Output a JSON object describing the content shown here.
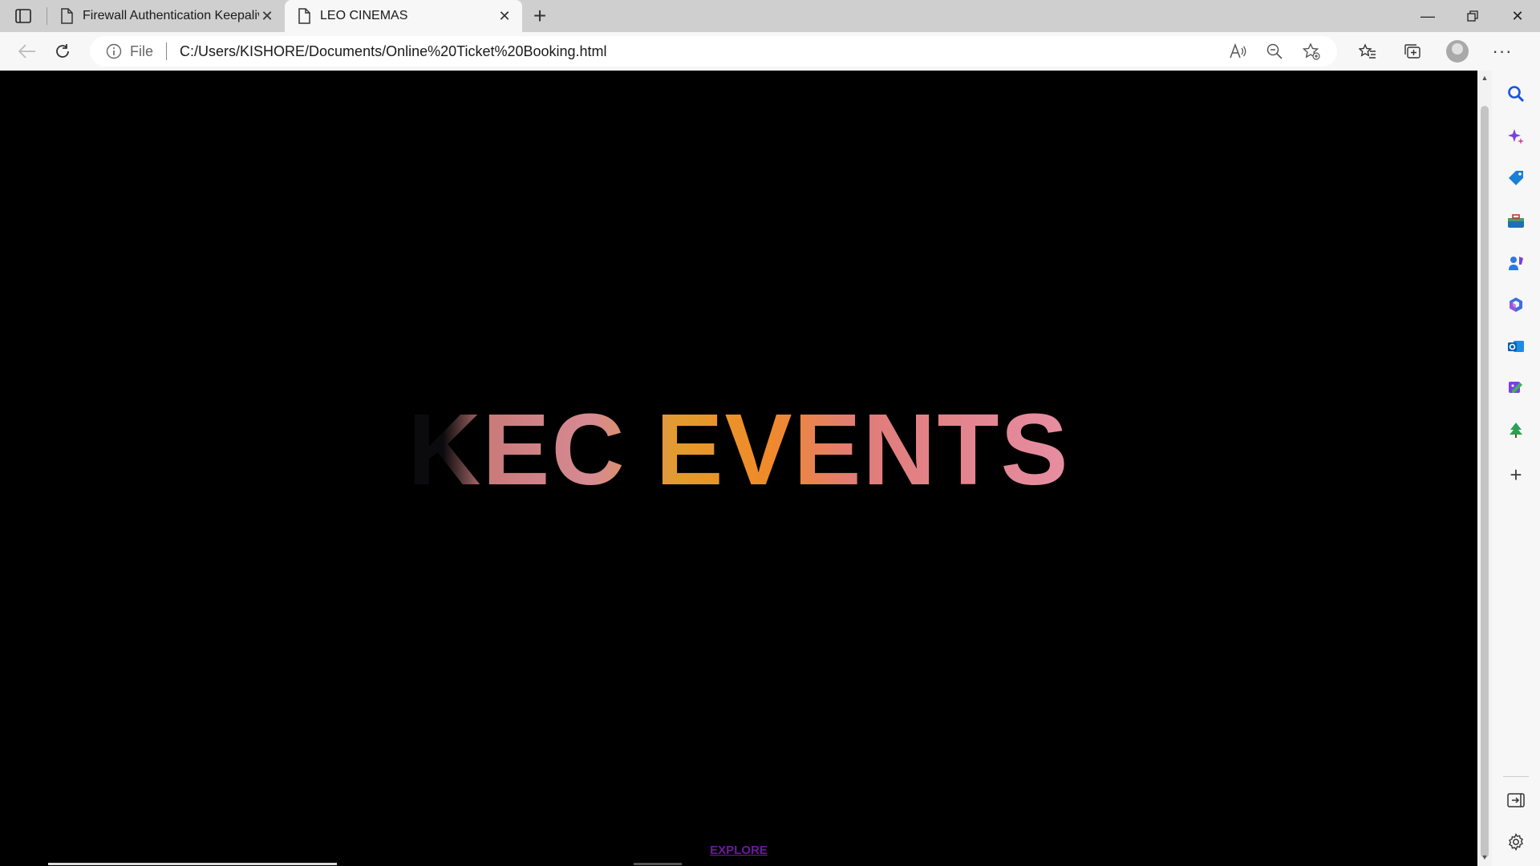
{
  "browser": {
    "tabs": [
      {
        "title": "Firewall Authentication Keepalive",
        "active": false
      },
      {
        "title": "LEO CINEMAS",
        "active": true
      }
    ],
    "address": {
      "scheme_label": "File",
      "url": "C:/Users/KISHORE/Documents/Online%20Ticket%20Booking.html"
    },
    "sidebar": {
      "items": [
        "search-icon",
        "copilot-icon",
        "shopping-icon",
        "tools-icon",
        "games-icon",
        "microsoft365-icon",
        "outlook-icon",
        "designer-icon",
        "tree-icon",
        "add-icon"
      ],
      "bottom": [
        "hide-sidebar-icon",
        "settings-icon"
      ]
    }
  },
  "page": {
    "hero_title": "KEC EVENTS",
    "explore_link": "EXPLORE",
    "colors": {
      "background": "#000000",
      "link": "#6a1b9a",
      "accent_orange": "#f08a2a",
      "accent_pink": "#e8a0b3"
    }
  }
}
